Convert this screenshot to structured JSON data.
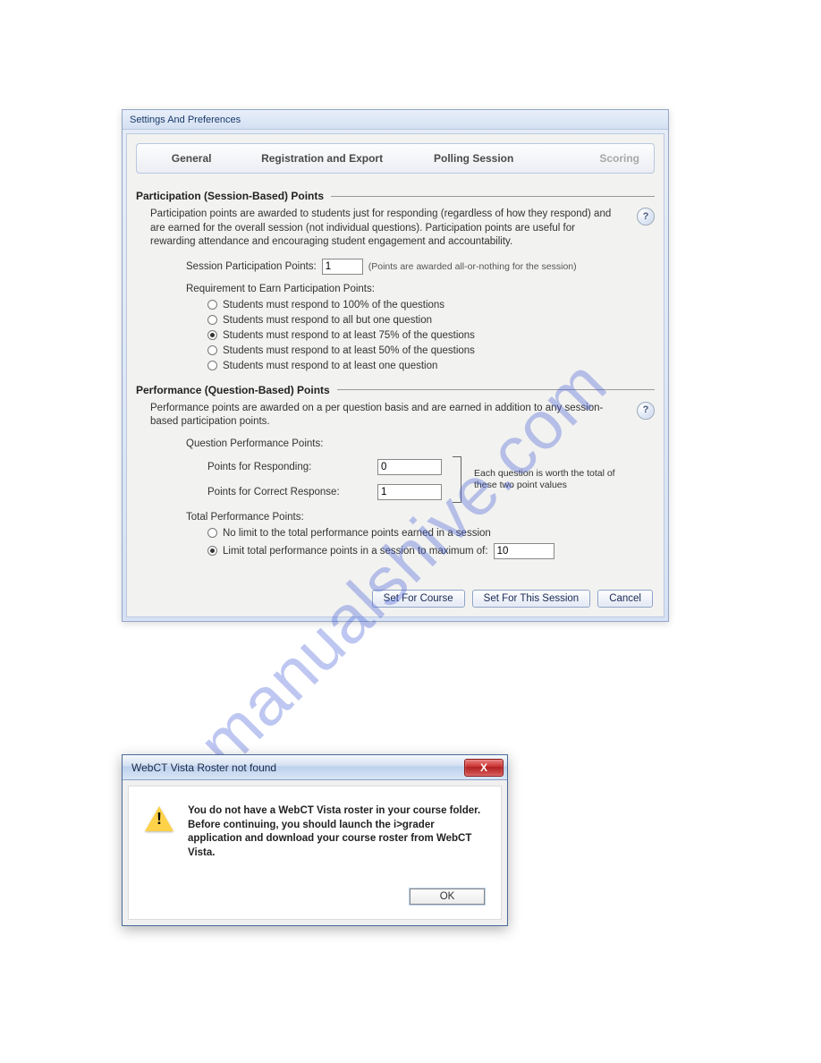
{
  "watermark": "manualshive.com",
  "settings": {
    "title": "Settings And Preferences",
    "tabs": {
      "general": "General",
      "registration": "Registration and Export",
      "polling": "Polling Session",
      "scoring": "Scoring"
    },
    "participation": {
      "heading": "Participation (Session-Based) Points",
      "description": "Participation points are awarded to students just for responding (regardless of how they respond) and are earned for the overall session (not individual questions). Participation points are useful for rewarding attendance and encouraging student engagement and accountability.",
      "session_points_label": "Session Participation Points:",
      "session_points_value": "1",
      "session_points_note": "(Points are awarded all-or-nothing for the session)",
      "requirement_label": "Requirement to Earn Participation Points:",
      "options": [
        "Students must respond to 100% of the questions",
        "Students must respond to all but one question",
        "Students must respond to at least 75% of the questions",
        "Students must respond to at least 50% of the questions",
        "Students must respond to at least one question"
      ],
      "selected_index": 2
    },
    "performance": {
      "heading": "Performance (Question-Based) Points",
      "description": "Performance points are awarded on a per question basis and are earned in addition to any session-based participation points.",
      "qpp_label": "Question Performance Points:",
      "responding_label": "Points for Responding:",
      "responding_value": "0",
      "correct_label": "Points for Correct Response:",
      "correct_value": "1",
      "bracket_note": "Each question is worth the total of these two point values",
      "total_label": "Total Performance Points:",
      "total_options": {
        "nolimit": "No limit to the total performance points earned in a session",
        "limit": "Limit total performance points in a session to maximum of:"
      },
      "limit_value": "10",
      "selected": "limit"
    },
    "buttons": {
      "set_course": "Set For Course",
      "set_session": "Set For This Session",
      "cancel": "Cancel"
    },
    "help": "?"
  },
  "alert": {
    "title": "WebCT Vista Roster not found",
    "message": "You do not have a WebCT Vista roster in your course folder. Before continuing, you should launch the i>grader application and download your course roster from WebCT Vista.",
    "ok": "OK",
    "close": "X"
  }
}
